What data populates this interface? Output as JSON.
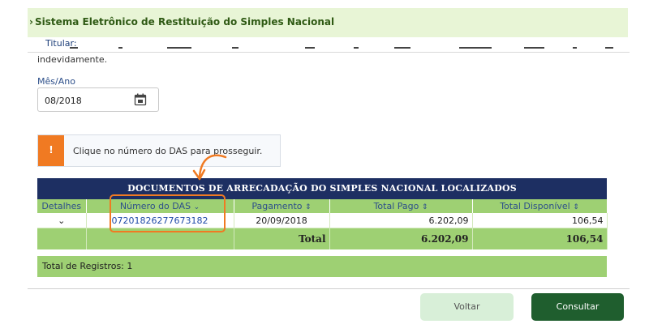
{
  "header": {
    "title": "Sistema Eletrônico de Restituição do Simples Nacional",
    "titular_label": "Titular:",
    "intro_text": "indevidamente."
  },
  "form": {
    "period_label": "Mês/Ano",
    "period_value": "08/2018",
    "calendar_icon": "calendar-icon"
  },
  "alert": {
    "icon": "!",
    "message": "Clique no número do DAS para prosseguir.",
    "color": "#f07a22"
  },
  "table": {
    "title": "DOCUMENTOS DE ARRECADAÇÃO DO SIMPLES NACIONAL LOCALIZADOS",
    "columns": [
      "Detalhes",
      "Número do DAS",
      "Pagamento",
      "Total Pago",
      "Total Disponível"
    ],
    "sort_glyphs": [
      "⌄",
      "⇕",
      "⇕",
      "⇕"
    ],
    "rows": [
      {
        "detalhes": "⌄",
        "numero_das": "07201826277673182",
        "pagamento": "20/09/2018",
        "total_pago": "6.202,09",
        "total_disponivel": "106,54"
      }
    ],
    "total": {
      "label": "Total",
      "total_pago": "6.202,09",
      "total_disponivel": "106,54"
    },
    "registros": "Total de Registros: 1"
  },
  "buttons": {
    "voltar": "Voltar",
    "consultar": "Consultar"
  },
  "colors": {
    "header_band": "#e8f5d6",
    "table_title_bg": "#1d2f62",
    "table_green": "#9ed073",
    "primary_button": "#1f5e2e",
    "highlight": "#f07a22"
  }
}
